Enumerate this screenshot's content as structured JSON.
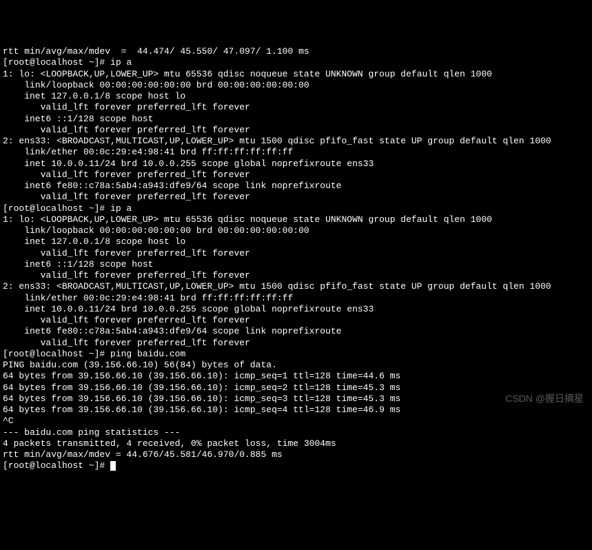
{
  "terminal": {
    "line_top": "rtt min/avg/max/mdev  =  44.474/ 45.550/ 47.097/ 1.100 ms",
    "prompt1": "[root@localhost ~]# ip a",
    "lo_block": [
      "1: lo: <LOOPBACK,UP,LOWER_UP> mtu 65536 qdisc noqueue state UNKNOWN group default qlen 1000",
      "    link/loopback 00:00:00:00:00:00 brd 00:00:00:00:00:00",
      "    inet 127.0.0.1/8 scope host lo",
      "       valid_lft forever preferred_lft forever",
      "    inet6 ::1/128 scope host",
      "       valid_lft forever preferred_lft forever"
    ],
    "ens33_block": [
      "2: ens33: <BROADCAST,MULTICAST,UP,LOWER_UP> mtu 1500 qdisc pfifo_fast state UP group default qlen 1000",
      "    link/ether 00:0c:29:e4:98:41 brd ff:ff:ff:ff:ff:ff",
      "    inet 10.0.0.11/24 brd 10.0.0.255 scope global noprefixroute ens33",
      "       valid_lft forever preferred_lft forever",
      "    inet6 fe80::c78a:5ab4:a943:dfe9/64 scope link noprefixroute",
      "       valid_lft forever preferred_lft forever"
    ],
    "prompt2": "[root@localhost ~]# ip a",
    "lo_block2": [
      "1: lo: <LOOPBACK,UP,LOWER_UP> mtu 65536 qdisc noqueue state UNKNOWN group default qlen 1000",
      "    link/loopback 00:00:00:00:00:00 brd 00:00:00:00:00:00",
      "    inet 127.0.0.1/8 scope host lo",
      "       valid_lft forever preferred_lft forever",
      "    inet6 ::1/128 scope host",
      "       valid_lft forever preferred_lft forever"
    ],
    "ens33_block2": [
      "2: ens33: <BROADCAST,MULTICAST,UP,LOWER_UP> mtu 1500 qdisc pfifo_fast state UP group default qlen 1000",
      "    link/ether 00:0c:29:e4:98:41 brd ff:ff:ff:ff:ff:ff",
      "    inet 10.0.0.11/24 brd 10.0.0.255 scope global noprefixroute ens33",
      "       valid_lft forever preferred_lft forever",
      "    inet6 fe80::c78a:5ab4:a943:dfe9/64 scope link noprefixroute",
      "       valid_lft forever preferred_lft forever"
    ],
    "prompt3": "[root@localhost ~]# ping baidu.com",
    "ping_header": "PING baidu.com (39.156.66.10) 56(84) bytes of data.",
    "ping_replies": [
      "64 bytes from 39.156.66.10 (39.156.66.10): icmp_seq=1 ttl=128 time=44.6 ms",
      "64 bytes from 39.156.66.10 (39.156.66.10): icmp_seq=2 ttl=128 time=45.3 ms",
      "64 bytes from 39.156.66.10 (39.156.66.10): icmp_seq=3 ttl=128 time=45.3 ms",
      "64 bytes from 39.156.66.10 (39.156.66.10): icmp_seq=4 ttl=128 time=46.9 ms"
    ],
    "interrupt": "^C",
    "stats_header": "--- baidu.com ping statistics ---",
    "stats_line1": "4 packets transmitted, 4 received, 0% packet loss, time 3004ms",
    "stats_line2": "rtt min/avg/max/mdev = 44.676/45.581/46.970/0.885 ms",
    "prompt4": "[root@localhost ~]# "
  },
  "watermark": "CSDN @握日摘星"
}
